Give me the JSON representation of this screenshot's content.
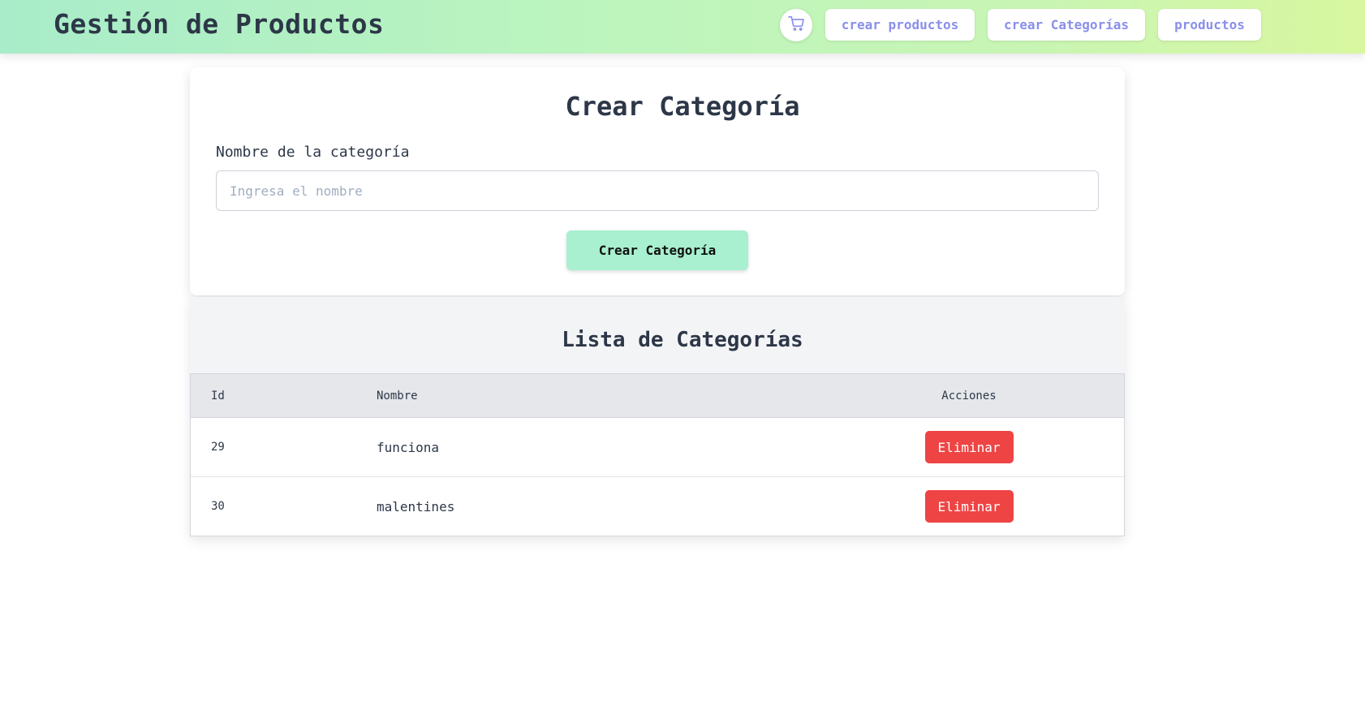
{
  "header": {
    "title": "Gestión de Productos",
    "cart_icon": "cart-icon",
    "nav": [
      {
        "label": "crear productos"
      },
      {
        "label": "crear Categorías"
      },
      {
        "label": "productos"
      }
    ]
  },
  "form": {
    "title": "Crear Categoría",
    "label": "Nombre de la categoría",
    "placeholder": "Ingresa el nombre",
    "value": "",
    "submit_label": "Crear Categoría"
  },
  "list": {
    "title": "Lista de Categorías",
    "columns": [
      "Id",
      "Nombre",
      "Acciones"
    ],
    "rows": [
      {
        "id": "29",
        "name": "funciona",
        "action": "Eliminar"
      },
      {
        "id": "30",
        "name": "malentines",
        "action": "Eliminar"
      }
    ]
  },
  "colors": {
    "accent_text": "#8a8fea",
    "primary_button": "#a8f0cf",
    "danger_button": "#ef4444",
    "header_gradient_start": "#a8ecc9",
    "header_gradient_end": "#d8f79f"
  }
}
